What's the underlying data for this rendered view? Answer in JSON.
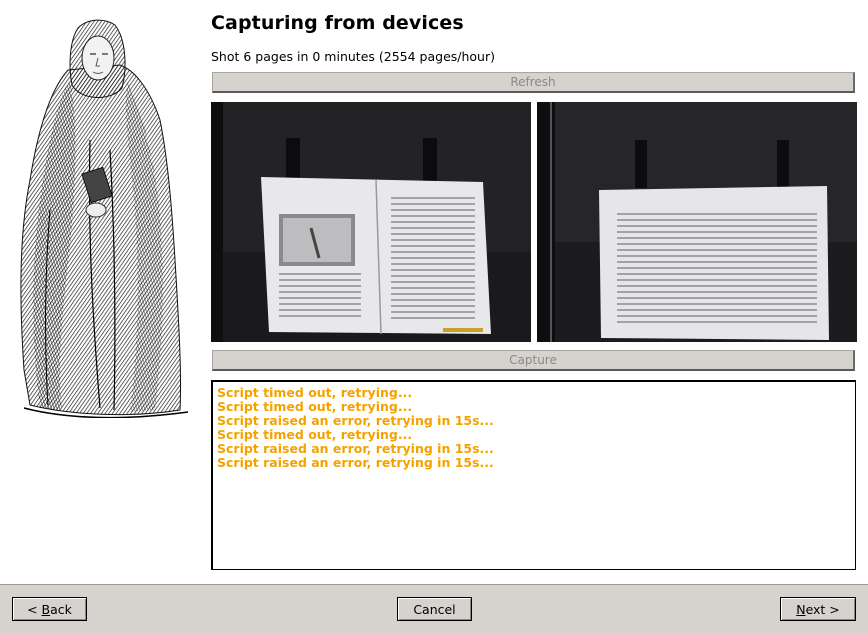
{
  "page": {
    "title": "Capturing from devices",
    "status": "Shot 6 pages in 0 minutes (2554 pages/hour)"
  },
  "buttons": {
    "refresh": "Refresh",
    "capture": "Capture",
    "back_prefix": "< ",
    "back_mnemonic": "B",
    "back_rest": "ack",
    "cancel": "Cancel",
    "next_mnemonic": "N",
    "next_rest": "ext >"
  },
  "log": {
    "lines": [
      "Script timed out, retrying...",
      "Script timed out, retrying...",
      "Script raised an error, retrying in 15s...",
      "Script timed out, retrying...",
      "Script raised an error, retrying in 15s...",
      "Script raised an error, retrying in 15s..."
    ],
    "color": "#f5a200"
  },
  "images": {
    "illustration": "monk-engraving",
    "previews": [
      "left-camera-preview",
      "right-camera-preview"
    ]
  }
}
